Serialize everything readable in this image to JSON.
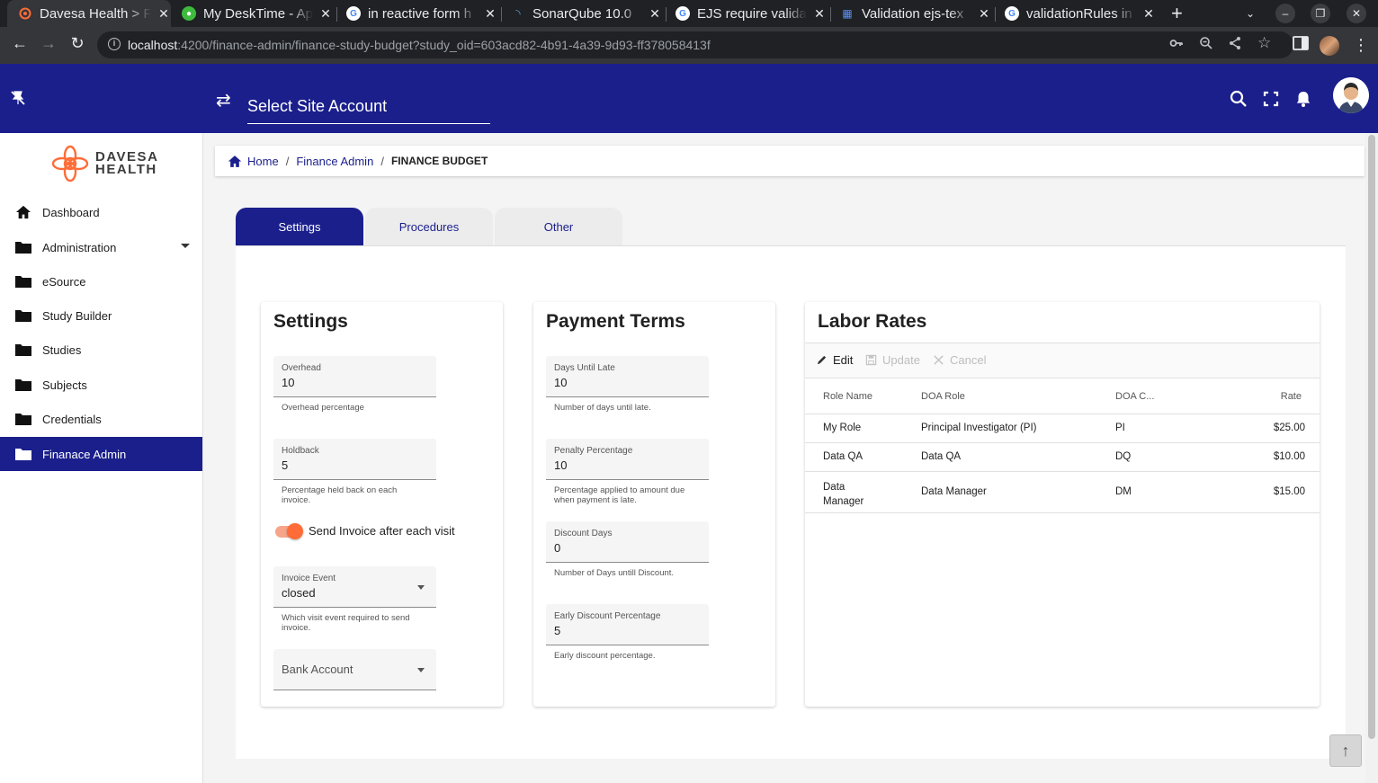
{
  "browser": {
    "tabs": [
      {
        "title": "Davesa Health > Finance Admin",
        "active": true
      },
      {
        "title": "My DeskTime - Ap",
        "active": false
      },
      {
        "title": "in reactive form h",
        "active": false
      },
      {
        "title": "SonarQube 10.0",
        "active": false
      },
      {
        "title": "EJS require valida",
        "active": false
      },
      {
        "title": "Validation ejs-tex",
        "active": false
      },
      {
        "title": "validationRules in",
        "active": false
      }
    ],
    "url_host": "localhost",
    "url_rest": ":4200/finance-admin/finance-study-budget?study_oid=603acd82-4b91-4a39-9d93-ff378058413f"
  },
  "header": {
    "site_account_placeholder": "Select Site Account"
  },
  "sidebar": {
    "logo_line1": "DAVESA",
    "logo_line2": "HEALTH",
    "items": [
      {
        "label": "Dashboard",
        "icon": "home-icon"
      },
      {
        "label": "Administration",
        "icon": "folder-icon"
      },
      {
        "label": "eSource",
        "icon": "folder-icon"
      },
      {
        "label": "Study Builder",
        "icon": "folder-icon"
      },
      {
        "label": "Studies",
        "icon": "folder-icon"
      },
      {
        "label": "Subjects",
        "icon": "folder-icon"
      },
      {
        "label": "Credentials",
        "icon": "folder-icon"
      },
      {
        "label": "Finanace Admin",
        "icon": "folder-icon"
      }
    ]
  },
  "breadcrumb": {
    "home": "Home",
    "finance_admin": "Finance Admin",
    "current": "FINANCE BUDGET"
  },
  "tabs": [
    "Settings",
    "Procedures",
    "Other"
  ],
  "settings": {
    "title": "Settings",
    "overhead": {
      "label": "Overhead",
      "value": "10",
      "hint": "Overhead percentage"
    },
    "holdback": {
      "label": "Holdback",
      "value": "5",
      "hint": "Percentage held back on each invoice."
    },
    "send_invoice_label": "Send Invoice after each visit",
    "send_invoice_on": true,
    "invoice_event": {
      "label": "Invoice Event",
      "value": "closed",
      "hint": "Which visit event required to send invoice."
    },
    "bank_account": {
      "placeholder": "Bank Account"
    }
  },
  "payment_terms": {
    "title": "Payment Terms",
    "days_until_late": {
      "label": "Days Until Late",
      "value": "10",
      "hint": "Number of days until late."
    },
    "penalty_percentage": {
      "label": "Penalty Percentage",
      "value": "10",
      "hint": "Percentage applied to amount due when payment is late."
    },
    "discount_days": {
      "label": "Discount Days",
      "value": "0",
      "hint": "Number of Days untill Discount."
    },
    "early_discount": {
      "label": "Early Discount Percentage",
      "value": "5",
      "hint": "Early discount percentage."
    }
  },
  "labor_rates": {
    "title": "Labor Rates",
    "toolbar": {
      "edit": "Edit",
      "update": "Update",
      "cancel": "Cancel"
    },
    "columns": [
      "Role Name",
      "DOA Role",
      "DOA C...",
      "Rate"
    ],
    "rows": [
      {
        "role_name": "My Role",
        "doa_role": "Principal Investigator (PI)",
        "doa_code": "PI",
        "rate": "$25.00"
      },
      {
        "role_name": "Data QA",
        "doa_role": "Data QA",
        "doa_code": "DQ",
        "rate": "$10.00"
      },
      {
        "role_name": "Data Manager",
        "doa_role": "Data Manager",
        "doa_code": "DM",
        "rate": "$15.00"
      }
    ]
  },
  "colors": {
    "brand_navy": "#1a1f8c",
    "accent_orange": "#ff6c37"
  }
}
